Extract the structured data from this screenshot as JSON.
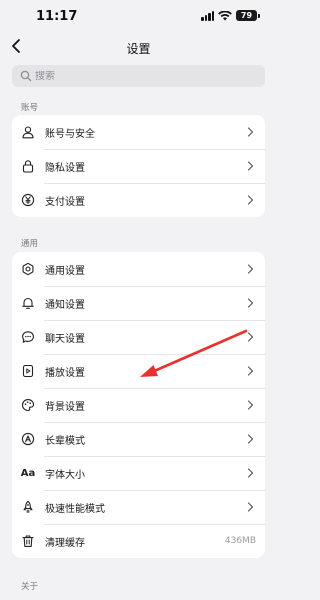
{
  "status_bar": {
    "time": "11:17",
    "battery": "79"
  },
  "nav": {
    "title": "设置",
    "back_icon": "chevron-left-icon"
  },
  "search": {
    "placeholder": "搜索",
    "value": "",
    "icon": "search-icon"
  },
  "sections": [
    {
      "title": "账号",
      "items": [
        {
          "label": "账号与安全",
          "icon": "person-icon"
        },
        {
          "label": "隐私设置",
          "icon": "lock-icon"
        },
        {
          "label": "支付设置",
          "icon": "yen-icon"
        }
      ]
    },
    {
      "title": "通用",
      "items": [
        {
          "label": "通用设置",
          "icon": "gear-icon"
        },
        {
          "label": "通知设置",
          "icon": "bell-icon"
        },
        {
          "label": "聊天设置",
          "icon": "chat-bubble-icon"
        },
        {
          "label": "播放设置",
          "icon": "play-file-icon"
        },
        {
          "label": "背景设置",
          "icon": "palette-icon"
        },
        {
          "label": "长辈模式",
          "icon": "elder-mode-icon"
        },
        {
          "label": "字体大小",
          "icon": "font-size-icon",
          "glyph": "Aa"
        },
        {
          "label": "极速性能模式",
          "icon": "rocket-icon"
        },
        {
          "label": "清理缓存",
          "icon": "trash-icon",
          "value": "436MB"
        }
      ]
    },
    {
      "title": "关于"
    }
  ],
  "annotation": {
    "color": "#e8322f",
    "points_to": "播放设置"
  }
}
